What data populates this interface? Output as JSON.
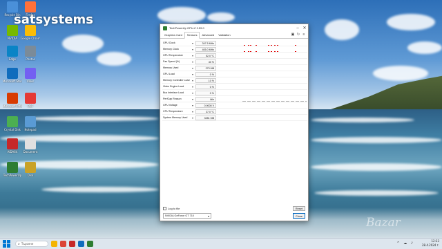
{
  "brand": {
    "text": "satsystems"
  },
  "desktop_icons": [
    {
      "label": "Recycle Bin",
      "icon": "recycle-bin-icon",
      "color": "#4a90d9"
    },
    {
      "label": "NVIDIA",
      "icon": "nvidia-icon",
      "color": "#76b900"
    },
    {
      "label": "Edge",
      "icon": "edge-icon",
      "color": "#0a84c6"
    },
    {
      "label": "Microsoft Store",
      "icon": "store-icon",
      "color": "#0f6cbd"
    },
    {
      "label": "Microsoft Office",
      "icon": "office-icon",
      "color": "#d83b01"
    },
    {
      "label": "Crystal Disk",
      "icon": "disk-icon",
      "color": "#4caf50"
    },
    {
      "label": "AIDA64",
      "icon": "aida64-icon",
      "color": "#c62828"
    },
    {
      "label": "TechPowerUp",
      "icon": "gpuz-icon",
      "color": "#2e7d32"
    },
    {
      "label": "Firefox",
      "icon": "firefox-icon",
      "color": "#ff7139"
    },
    {
      "label": "Google Chrome",
      "icon": "chrome-icon",
      "color": "#fbbc05"
    },
    {
      "label": "Photos",
      "icon": "photos-icon",
      "color": "#7b8b99"
    },
    {
      "label": "Viber",
      "icon": "viber-icon",
      "color": "#7360f2"
    },
    {
      "label": "PDF",
      "icon": "pdf-icon",
      "color": "#e53935"
    },
    {
      "label": "Notepad",
      "icon": "notepad-icon",
      "color": "#5a9bd4"
    },
    {
      "label": "Document",
      "icon": "document-icon",
      "color": "#e0e0e0"
    },
    {
      "label": "Disk",
      "icon": "cd-icon",
      "color": "#c9a227"
    },
    {
      "label": "Recycle",
      "icon": "recycle-icon",
      "color": "#c0c8d0"
    }
  ],
  "window": {
    "title": "TechPowerUp GPU-Z 2.59.0",
    "tabs": [
      "Graphics Card",
      "Sensors",
      "Advanced",
      "Validation"
    ],
    "active_tab": 1,
    "sensors": [
      {
        "name": "GPU Clock",
        "value": "347.5 MHz",
        "graph": "spikes",
        "color": "#e00000"
      },
      {
        "name": "Memory Clock",
        "value": "405.0 MHz",
        "graph": "spikes-base",
        "color": "#e00000"
      },
      {
        "name": "GPU Temperature",
        "value": "52.0 °C",
        "graph": "line",
        "color": "#e00000"
      },
      {
        "name": "Fan Speed (%)",
        "value": "40 %",
        "graph": "line",
        "color": "#e00000"
      },
      {
        "name": "Memory Used",
        "value": "273 MB",
        "graph": "line",
        "color": "#e00000"
      },
      {
        "name": "GPU Load",
        "value": "0 %",
        "graph": "low",
        "color": "#e00000"
      },
      {
        "name": "Memory Controller Load",
        "value": "10 %",
        "graph": "low-dash",
        "color": "#e00000"
      },
      {
        "name": "Video Engine Load",
        "value": "0 %",
        "graph": "none",
        "color": "#e00000"
      },
      {
        "name": "Bus Interface Load",
        "value": "0 %",
        "graph": "none",
        "color": "#e00000"
      },
      {
        "name": "PerfCap Reason",
        "value": "Idle",
        "graph": "blocks",
        "color": "#b5b5b5"
      },
      {
        "name": "GPU Voltage",
        "value": "0.9000 V",
        "graph": "line",
        "color": "#e00000"
      },
      {
        "name": "CPU Temperature",
        "value": "37.0 °C",
        "graph": "low",
        "color": "#e00000"
      },
      {
        "name": "System Memory Used",
        "value": "3281 MB",
        "graph": "line",
        "color": "#e00000"
      }
    ],
    "log_label": "Log to file",
    "reset_label": "Reset",
    "gpu_selected": "NVIDIA GeForce GT 710",
    "close_label": "Close"
  },
  "taskbar": {
    "search_placeholder": "Търсене",
    "apps": [
      {
        "icon": "file-explorer-icon",
        "color": "#f4b400"
      },
      {
        "icon": "chrome-icon",
        "color": "#db4437"
      },
      {
        "icon": "aida64-icon",
        "color": "#c62828"
      },
      {
        "icon": "store-icon",
        "color": "#0f6cbd"
      },
      {
        "icon": "gpuz-icon",
        "color": "#2e7d32"
      }
    ],
    "time": "12:33",
    "date": "28.4.2024 г."
  },
  "watermark": "Bazar"
}
